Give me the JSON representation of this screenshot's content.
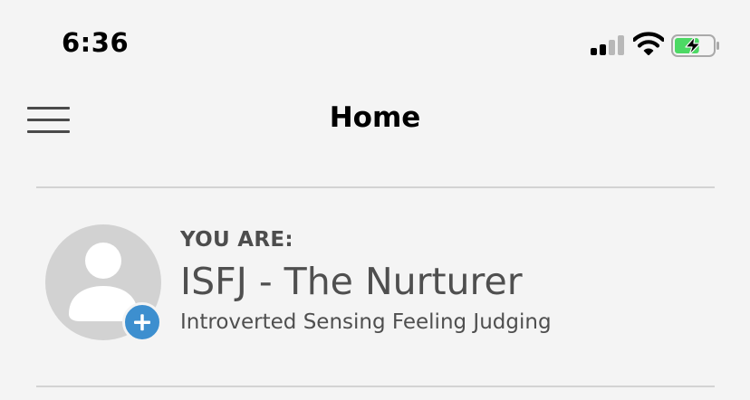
{
  "status_bar": {
    "time": "6:36",
    "signal_bars_active": 2,
    "signal_bars_total": 4,
    "battery_charging": true,
    "battery_level": 0.65,
    "battery_color": "#4cd964"
  },
  "nav": {
    "menu_icon": "hamburger-menu-icon",
    "title": "Home"
  },
  "profile": {
    "avatar_icon": "default-user-avatar-icon",
    "add_icon": "plus-icon",
    "heading": "YOU ARE:",
    "type_name": "ISFJ - The Nurturer",
    "type_description": "Introverted Sensing Feeling Judging"
  },
  "colors": {
    "background": "#f4f4f4",
    "accent": "#3d8fcf",
    "divider": "#d3d3d3",
    "avatar": "#d2d2d2"
  }
}
